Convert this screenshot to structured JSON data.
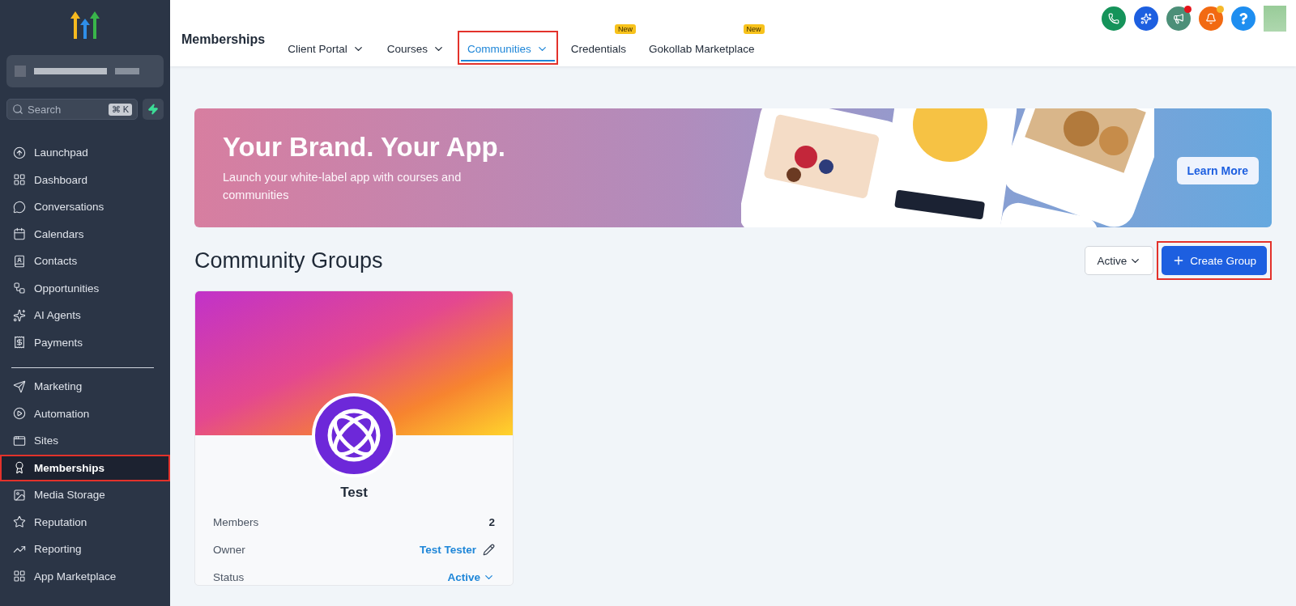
{
  "sidebar": {
    "search": {
      "placeholder": "Search",
      "shortcut": "⌘ K"
    },
    "items": [
      {
        "label": "Launchpad",
        "selected": false,
        "highlighted": false
      },
      {
        "label": "Dashboard",
        "selected": false,
        "highlighted": false
      },
      {
        "label": "Conversations",
        "selected": false,
        "highlighted": false
      },
      {
        "label": "Calendars",
        "selected": false,
        "highlighted": false
      },
      {
        "label": "Contacts",
        "selected": false,
        "highlighted": false
      },
      {
        "label": "Opportunities",
        "selected": false,
        "highlighted": false
      },
      {
        "label": "AI Agents",
        "selected": false,
        "highlighted": false
      },
      {
        "label": "Payments",
        "selected": false,
        "highlighted": false
      }
    ],
    "items_2": [
      {
        "label": "Marketing",
        "selected": false,
        "highlighted": false
      },
      {
        "label": "Automation",
        "selected": false,
        "highlighted": false
      },
      {
        "label": "Sites",
        "selected": false,
        "highlighted": false
      },
      {
        "label": "Memberships",
        "selected": true,
        "highlighted": true
      },
      {
        "label": "Media Storage",
        "selected": false,
        "highlighted": false
      },
      {
        "label": "Reputation",
        "selected": false,
        "highlighted": false
      },
      {
        "label": "Reporting",
        "selected": false,
        "highlighted": false
      },
      {
        "label": "App Marketplace",
        "selected": false,
        "highlighted": false
      }
    ]
  },
  "header": {
    "title": "Memberships",
    "tabs": [
      {
        "label": "Client Portal",
        "dropdown": true,
        "selected": false,
        "highlighted": false
      },
      {
        "label": "Courses",
        "dropdown": true,
        "selected": false,
        "highlighted": false
      },
      {
        "label": "Communities",
        "dropdown": true,
        "selected": true,
        "highlighted": true
      },
      {
        "label": "Credentials",
        "dropdown": false,
        "badge": "New",
        "selected": false,
        "highlighted": false
      },
      {
        "label": "Gokollab Marketplace",
        "dropdown": false,
        "badge": "New",
        "selected": false,
        "highlighted": false
      }
    ],
    "action_buttons": [
      {
        "color": "#15935a"
      },
      {
        "color": "#1d5fe0"
      },
      {
        "color": "#4c8f78",
        "badge": {
          "color": "#e5141b"
        }
      },
      {
        "color": "#f26a12",
        "badge": {
          "color": "#f5b92a"
        }
      },
      {
        "color": "#1e8ef0"
      }
    ]
  },
  "banner": {
    "title": "Your Brand. Your App.",
    "subtitle": "Launch your white-label app with courses and communities",
    "button": "Learn More"
  },
  "section": {
    "title": "Community Groups",
    "filter": "Active",
    "create_button": {
      "label": "Create Group",
      "highlighted": true
    }
  },
  "groups": [
    {
      "name": "Test",
      "rows": [
        {
          "kind": "text",
          "label": "Members",
          "value": "2"
        },
        {
          "kind": "link",
          "label": "Owner",
          "value": "Test Tester"
        },
        {
          "kind": "dropdown",
          "label": "Status",
          "value": "Active"
        }
      ]
    }
  ]
}
